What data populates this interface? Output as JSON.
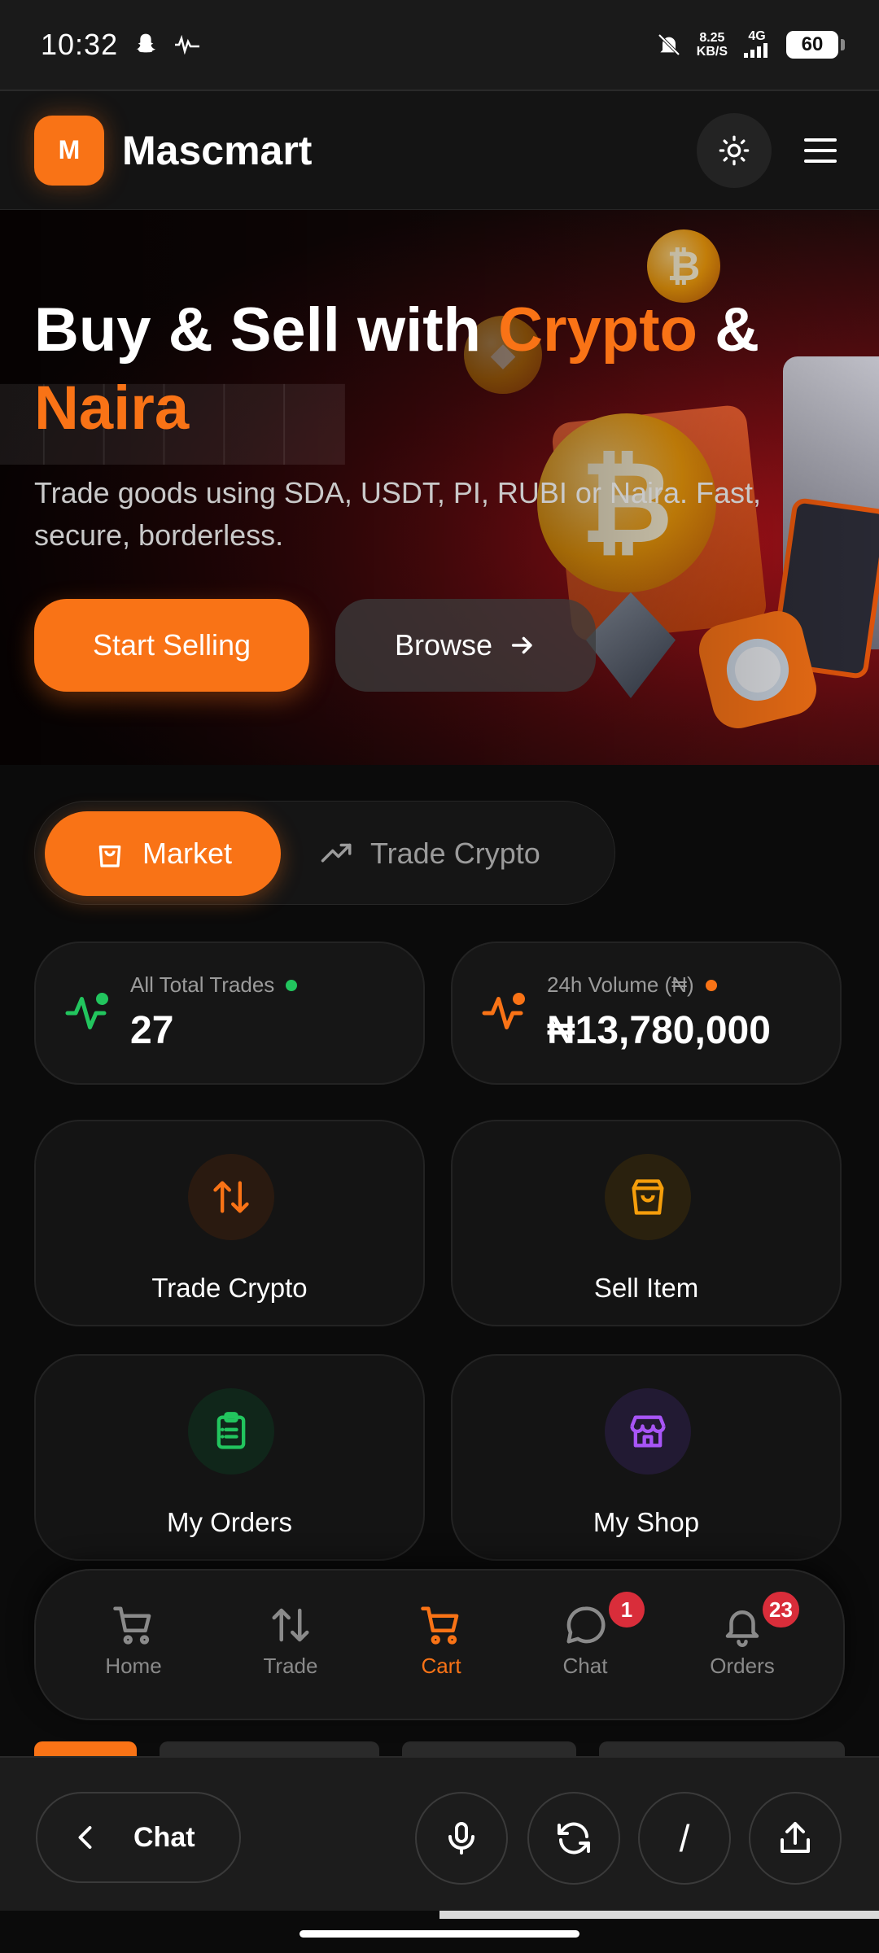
{
  "status_bar": {
    "time": "10:32",
    "net_speed_value": "8.25",
    "net_speed_unit": "KB/S",
    "network": "4G",
    "battery": "60"
  },
  "header": {
    "logo_letter": "M",
    "brand": "Mascmart"
  },
  "hero": {
    "title_part1": "Buy & Sell with ",
    "title_accent1": "Crypto",
    "title_part2": " &",
    "title_accent2": "Naira",
    "subtitle": "Trade goods using SDA, USDT, PI, RUBI or Naira. Fast, secure, borderless.",
    "sell_button": "Start Selling",
    "browse_button": "Browse",
    "accent_color": "#f97316"
  },
  "segmented_tabs": {
    "market": "Market",
    "trade_crypto": "Trade Crypto"
  },
  "stats": [
    {
      "label": "All Total Trades",
      "value": "27",
      "dot_color": "#22c55e",
      "icon": "activity-icon"
    },
    {
      "label": "24h Volume (₦)",
      "value": "₦13,780,000",
      "dot_color": "#f97316",
      "icon": "activity-icon"
    }
  ],
  "actions": [
    {
      "label": "Trade Crypto",
      "icon": "swap-arrows-icon",
      "color": "#f97316"
    },
    {
      "label": "Sell Item",
      "icon": "shopping-bag-icon",
      "color": "#f59e0b"
    },
    {
      "label": "My Orders",
      "icon": "clipboard-list-icon",
      "color": "#22c55e"
    },
    {
      "label": "My Shop",
      "icon": "store-icon",
      "color": "#a855f7"
    }
  ],
  "bottom_nav": {
    "items": [
      {
        "label": "Home",
        "icon": "cart-icon"
      },
      {
        "label": "Trade",
        "icon": "swap-arrows-icon"
      },
      {
        "label": "Cart",
        "icon": "cart-icon"
      },
      {
        "label": "Chat",
        "icon": "chat-bubble-icon",
        "badge": "1"
      },
      {
        "label": "Orders",
        "icon": "bell-icon",
        "badge": "23"
      }
    ],
    "active": "Cart"
  },
  "browser_bar": {
    "chat_label": "Chat",
    "slash": "/"
  }
}
